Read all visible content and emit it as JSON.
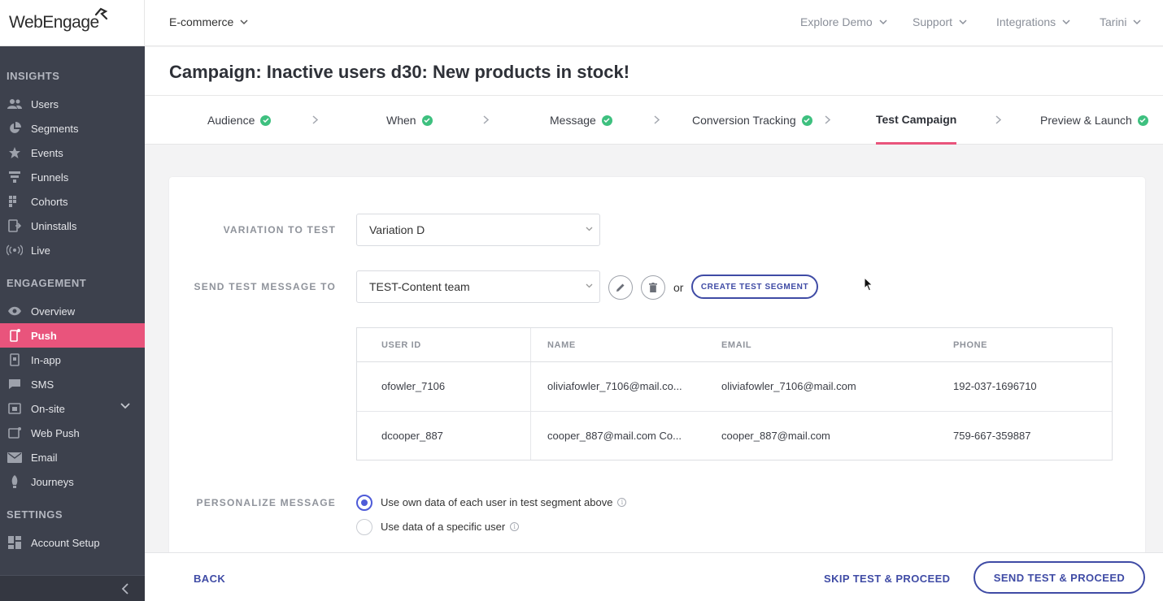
{
  "brand": {
    "logo_text": "WebEngage",
    "accent": "#e9547c",
    "primary": "#3f4ba5",
    "success": "#3ec07f"
  },
  "topbar": {
    "project": "E-commerce",
    "menu": [
      "Explore Demo",
      "Support",
      "Integrations",
      "Tarini"
    ]
  },
  "sidebar": {
    "sections": [
      {
        "title": "INSIGHTS",
        "items": [
          {
            "label": "Users",
            "icon": "users-icon"
          },
          {
            "label": "Segments",
            "icon": "pie-icon"
          },
          {
            "label": "Events",
            "icon": "star-icon"
          },
          {
            "label": "Funnels",
            "icon": "funnel-icon"
          },
          {
            "label": "Cohorts",
            "icon": "grid-icon"
          },
          {
            "label": "Uninstalls",
            "icon": "uninstall-icon"
          },
          {
            "label": "Live",
            "icon": "live-icon"
          }
        ]
      },
      {
        "title": "ENGAGEMENT",
        "items": [
          {
            "label": "Overview",
            "icon": "eye-icon"
          },
          {
            "label": "Push",
            "icon": "mobile-icon",
            "active": true
          },
          {
            "label": "In-app",
            "icon": "inapp-icon"
          },
          {
            "label": "SMS",
            "icon": "sms-icon"
          },
          {
            "label": "On-site",
            "icon": "onsite-icon",
            "expandable": true
          },
          {
            "label": "Web Push",
            "icon": "webpush-icon"
          },
          {
            "label": "Email",
            "icon": "email-icon"
          },
          {
            "label": "Journeys",
            "icon": "journey-icon"
          }
        ]
      },
      {
        "title": "SETTINGS",
        "items": [
          {
            "label": "Account Setup",
            "icon": "setup-icon"
          }
        ]
      }
    ]
  },
  "page": {
    "title": "Campaign: Inactive users d30: New products in stock!"
  },
  "steps": [
    {
      "label": "Audience",
      "done": true
    },
    {
      "label": "When",
      "done": true
    },
    {
      "label": "Message",
      "done": true
    },
    {
      "label": "Conversion Tracking",
      "done": true
    },
    {
      "label": "Test Campaign",
      "active": true
    },
    {
      "label": "Preview & Launch",
      "done": true
    }
  ],
  "form": {
    "variation_label": "VARIATION TO TEST",
    "variation_value": "Variation D",
    "send_label": "SEND TEST MESSAGE TO",
    "send_value": "TEST-Content team",
    "or_text": "or",
    "create_segment": "CREATE TEST SEGMENT",
    "personalize_label": "PERSONALIZE MESSAGE",
    "radio_own": "Use own data of each user in test segment above",
    "radio_specific": "Use data of a specific user"
  },
  "table": {
    "headers": [
      "USER ID",
      "NAME",
      "EMAIL",
      "PHONE"
    ],
    "rows": [
      [
        "ofowler_7106",
        "oliviafowler_7106@mail.co...",
        "oliviafowler_7106@mail.com",
        "192-037-1696710"
      ],
      [
        "dcooper_887",
        "cooper_887@mail.com Co...",
        "cooper_887@mail.com",
        "759-667-359887"
      ]
    ]
  },
  "footer": {
    "back": "BACK",
    "skip": "SKIP TEST & PROCEED",
    "send": "SEND TEST & PROCEED"
  }
}
